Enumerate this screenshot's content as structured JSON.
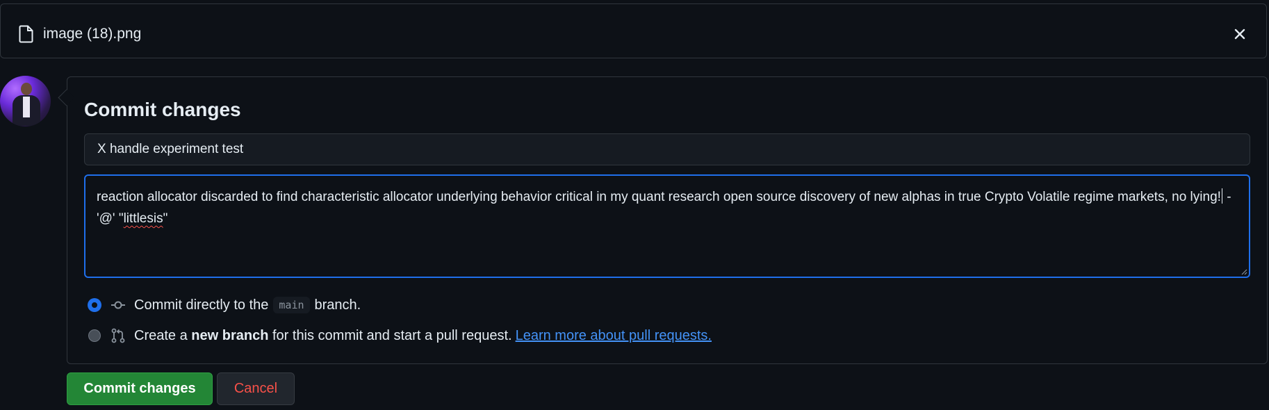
{
  "file": {
    "name": "image (18).png",
    "file_icon": "file-icon",
    "close_icon": "close-icon"
  },
  "avatar": {
    "icon": "user-avatar"
  },
  "form": {
    "title": "Commit changes",
    "summary_value": "X handle experiment test",
    "description_before_cursor": "reaction allocator discarded to find characteristic allocator underlying behavior critical in my quant research open source discovery of new alphas in true Crypto Volatile regime markets, no lying!",
    "description_after_cursor": " - '@' \"",
    "description_misspelled": "littlesis",
    "description_end": "\""
  },
  "options": {
    "direct": {
      "icon": "git-commit-icon",
      "label_prefix": "Commit directly to the",
      "branch": "main",
      "label_suffix": "branch.",
      "selected": true
    },
    "new_branch": {
      "icon": "git-pull-request-icon",
      "label_prefix": "Create a",
      "label_bold": "new branch",
      "label_suffix": "for this commit and start a pull request.",
      "link": "Learn more about pull requests.",
      "selected": false
    }
  },
  "buttons": {
    "commit": "Commit changes",
    "cancel": "Cancel"
  },
  "colors": {
    "background": "#0d1117",
    "border": "#30363d",
    "accent": "#1f6feb",
    "link": "#4493f8",
    "commit_button": "#238636",
    "cancel_text": "#f85149"
  }
}
